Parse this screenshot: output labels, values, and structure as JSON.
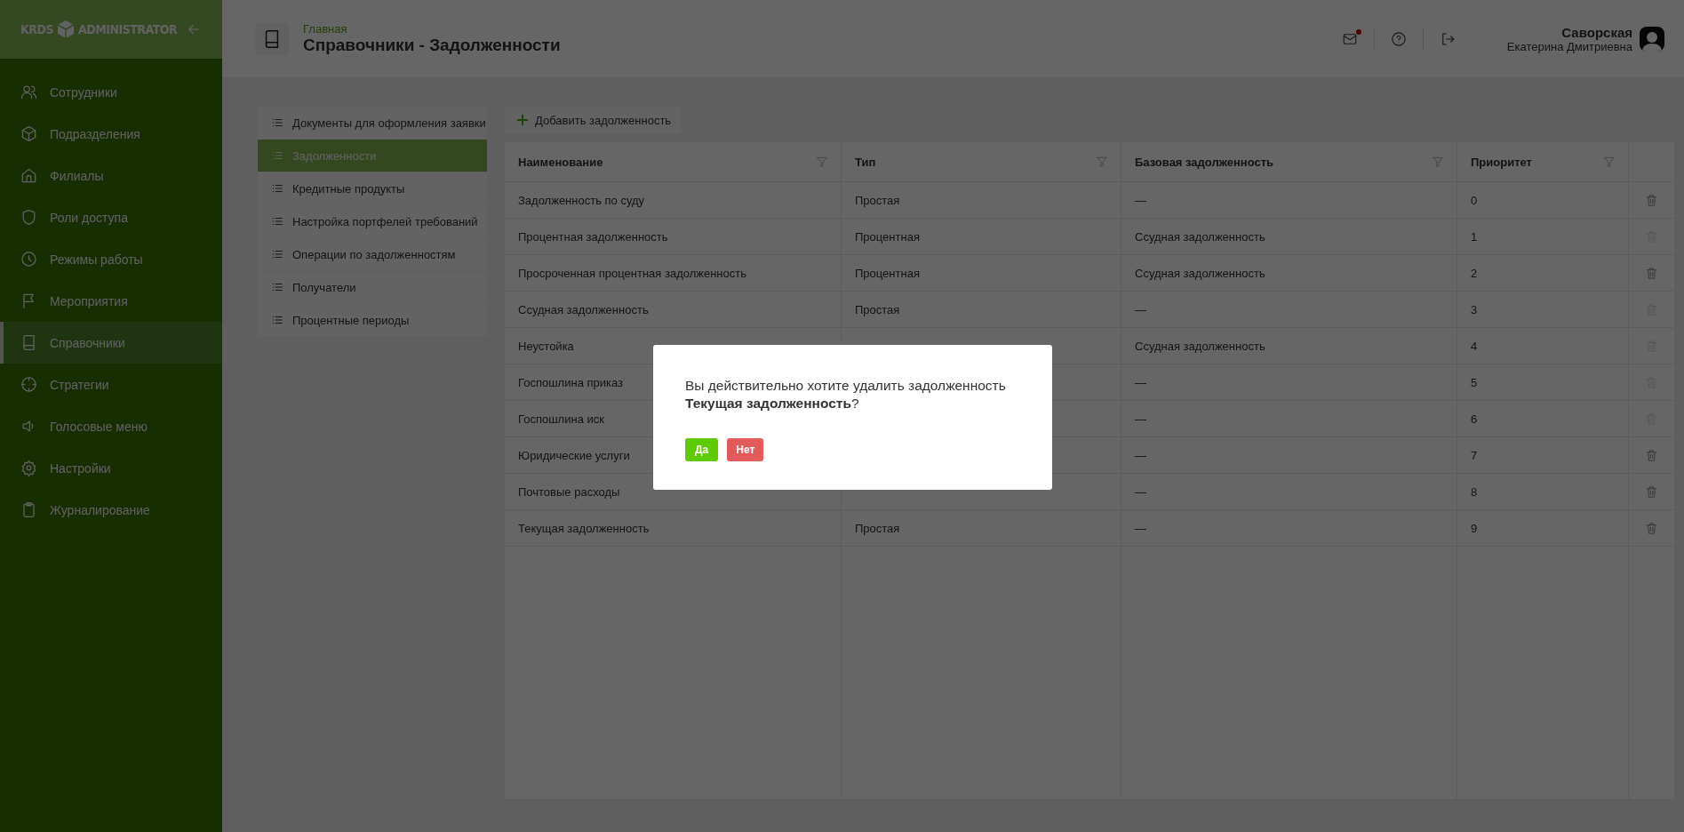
{
  "sidebar": {
    "logo_left": "KRDS",
    "logo_right": "ADMINISTRATOR",
    "items": [
      {
        "label": "Сотрудники",
        "selected": false
      },
      {
        "label": "Подразделения",
        "selected": false
      },
      {
        "label": "Филиалы",
        "selected": false
      },
      {
        "label": "Роли доступа",
        "selected": false
      },
      {
        "label": "Режимы работы",
        "selected": false
      },
      {
        "label": "Мероприятия",
        "selected": false
      },
      {
        "label": "Справочники",
        "selected": true
      },
      {
        "label": "Стратегии",
        "selected": false
      },
      {
        "label": "Голосовые меню",
        "selected": false
      },
      {
        "label": "Настройки",
        "selected": false
      },
      {
        "label": "Журналирование",
        "selected": false
      }
    ]
  },
  "header": {
    "breadcrumb": "Главная",
    "title": "Справочники - Задолженности",
    "mail_unread": true,
    "user": {
      "surname": "Саворская",
      "name": "Екатерина Дмитриевна"
    }
  },
  "submenu": {
    "items": [
      {
        "label": "Документы для оформления заявки",
        "selected": false
      },
      {
        "label": "Задолженности",
        "selected": true
      },
      {
        "label": "Кредитные продукты",
        "selected": false
      },
      {
        "label": "Настройка портфелей требований",
        "selected": false
      },
      {
        "label": "Операции по задолженностям",
        "selected": false
      },
      {
        "label": "Получатели",
        "selected": false
      },
      {
        "label": "Процентные периоды",
        "selected": false
      }
    ]
  },
  "table": {
    "add_button": "Добавить задолженность",
    "columns": [
      "Наименование",
      "Тип",
      "Базовая задолженность",
      "Приоритет"
    ],
    "rows": [
      {
        "name": "Задолженность по суду",
        "type": "Простая",
        "base": "—",
        "priority": "0",
        "delete_disabled": false
      },
      {
        "name": "Процентная задолженность",
        "type": "Процентная",
        "base": "Ссудная задолженность",
        "priority": "1",
        "delete_disabled": true
      },
      {
        "name": "Просроченная процентная задолженность",
        "type": "Процентная",
        "base": "Ссудная задолженность",
        "priority": "2",
        "delete_disabled": false
      },
      {
        "name": "Ссудная задолженность",
        "type": "Простая",
        "base": "—",
        "priority": "3",
        "delete_disabled": true
      },
      {
        "name": "Неустойка",
        "base": "Ссудная задолженность",
        "priority": "4",
        "delete_disabled": true
      },
      {
        "name": "Госпошлина приказ",
        "base": "—",
        "priority": "5",
        "delete_disabled": true
      },
      {
        "name": "Госпошлина иск",
        "base": "—",
        "priority": "6",
        "delete_disabled": true
      },
      {
        "name": "Юридические услуги",
        "base": "—",
        "priority": "7",
        "delete_disabled": false
      },
      {
        "name": "Почтовые расходы",
        "base": "—",
        "priority": "8",
        "delete_disabled": false
      },
      {
        "name": "Текущая задолженность",
        "type": "Простая",
        "base": "—",
        "priority": "9",
        "delete_disabled": false
      }
    ]
  },
  "modal": {
    "message": "Вы действительно хотите удалить задолженность **Текущая задолженность**?",
    "buttons": [
      {
        "label": "Да",
        "kind": "confirm"
      },
      {
        "label": "Нет",
        "kind": "cancel"
      }
    ]
  }
}
